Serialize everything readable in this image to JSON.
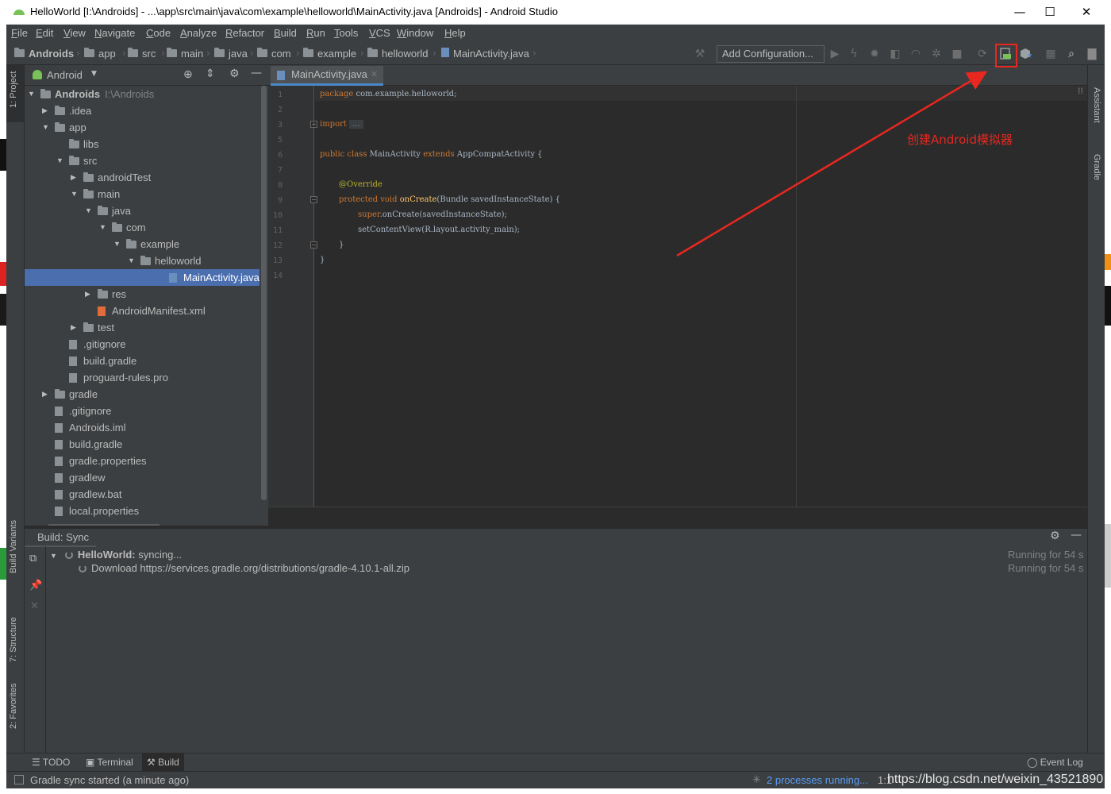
{
  "window": {
    "title": "HelloWorld [I:\\Androids] - ...\\app\\src\\main\\java\\com\\example\\helloworld\\MainActivity.java [Androids] - Android Studio",
    "minimize": "—",
    "maximize": "☐",
    "close": "✕"
  },
  "menu": [
    "File",
    "Edit",
    "View",
    "Navigate",
    "Code",
    "Analyze",
    "Refactor",
    "Build",
    "Run",
    "Tools",
    "VCS",
    "Window",
    "Help"
  ],
  "breadcrumbs": [
    "Androids",
    "app",
    "src",
    "main",
    "java",
    "com",
    "example",
    "helloworld",
    "MainActivity.java"
  ],
  "toolbar": {
    "add_config_label": "Add Configuration..."
  },
  "left_tool_tabs": [
    "1: Project",
    "Build Variants",
    "7: Structure",
    "2: Favorites"
  ],
  "right_tool_tabs": [
    "Assistant",
    "Gradle"
  ],
  "project": {
    "view_selector": "Android",
    "root_label": "Androids",
    "root_path": "I:\\Androids",
    "tree": [
      {
        "label": ".idea",
        "type": "folder"
      },
      {
        "label": "app",
        "type": "folder"
      },
      {
        "label": "libs",
        "type": "folder"
      },
      {
        "label": "src",
        "type": "folder"
      },
      {
        "label": "androidTest",
        "type": "folder"
      },
      {
        "label": "main",
        "type": "folder"
      },
      {
        "label": "java",
        "type": "folder"
      },
      {
        "label": "com",
        "type": "folder"
      },
      {
        "label": "example",
        "type": "folder"
      },
      {
        "label": "helloworld",
        "type": "folder"
      },
      {
        "label": "MainActivity.java",
        "type": "java"
      },
      {
        "label": "res",
        "type": "folder"
      },
      {
        "label": "AndroidManifest.xml",
        "type": "xml"
      },
      {
        "label": "test",
        "type": "folder"
      },
      {
        "label": ".gitignore",
        "type": "file"
      },
      {
        "label": "build.gradle",
        "type": "gradle"
      },
      {
        "label": "proguard-rules.pro",
        "type": "file"
      },
      {
        "label": "gradle",
        "type": "folder"
      },
      {
        "label": ".gitignore",
        "type": "file"
      },
      {
        "label": "Androids.iml",
        "type": "file"
      },
      {
        "label": "build.gradle",
        "type": "gradle"
      },
      {
        "label": "gradle.properties",
        "type": "file"
      },
      {
        "label": "gradlew",
        "type": "file"
      },
      {
        "label": "gradlew.bat",
        "type": "file"
      },
      {
        "label": "local.properties",
        "type": "file"
      }
    ]
  },
  "editor": {
    "tab_label": "MainActivity.java",
    "line_numbers": [
      "1",
      "2",
      "3",
      "5",
      "6",
      "7",
      "8",
      "9",
      "10",
      "11",
      "12",
      "13",
      "14"
    ],
    "code": {
      "l1_kw": "package",
      "l1_rest": " com.example.helloworld;",
      "l3_kw": "import",
      "l3_dots": "...",
      "l6_kw1": "public class",
      "l6_name": " MainActivity ",
      "l6_kw2": "extends",
      "l6_rest": " AppCompatActivity {",
      "l8_ann": "@Override",
      "l9_kw": "protected void",
      "l9_fn": " onCreate",
      "l9_rest": "(Bundle savedInstanceState) {",
      "l10_kw": "super",
      "l10_rest": ".onCreate(savedInstanceState);",
      "l11": "setContentView(R.layout.activity_main);",
      "l12": "}",
      "l13": "}"
    }
  },
  "build": {
    "title": "Build: Sync",
    "row1_name": "HelloWorld:",
    "row1_status": " syncing...",
    "row2": "Download https://services.gradle.org/distributions/gradle-4.10.1-all.zip",
    "time1": "Running for 54 s",
    "time2": "Running for 54 s"
  },
  "bottom_tabs": [
    "TODO",
    "Terminal",
    "Build"
  ],
  "event_log": "Event Log",
  "status": {
    "text": "Gradle sync started (a minute ago)",
    "processes": "2 processes running...",
    "caret": "1:1"
  },
  "watermark": "https://blog.csdn.net/weixin_43521890",
  "annotation": {
    "text": "创建Android模拟器",
    "color": "#e8271f"
  },
  "colors": {
    "selection": "#4b6eaf",
    "keyword": "#cc7832",
    "annotation_code": "#bbb529",
    "function": "#ffc66d",
    "panel_bg": "#3c3f41",
    "editor_bg": "#2b2b2b",
    "link": "#589df6"
  }
}
